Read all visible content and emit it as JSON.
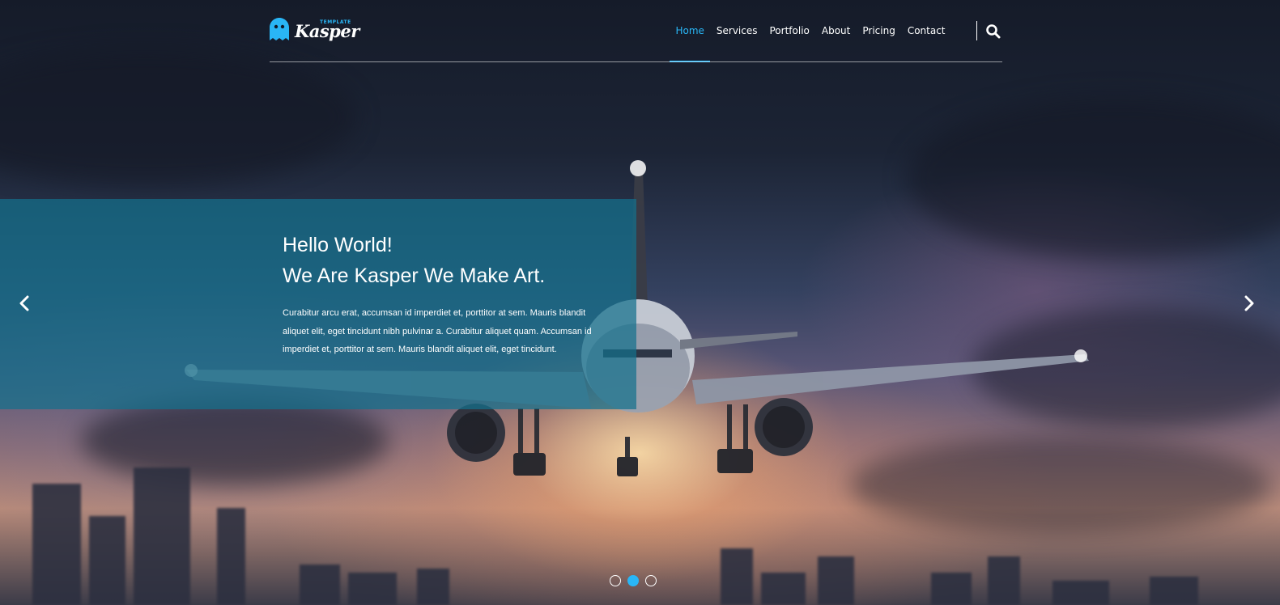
{
  "brand": {
    "name": "Kasper",
    "tagline": "TEMPLATE",
    "accent_color": "#29b6f6"
  },
  "nav": {
    "items": [
      {
        "label": "Home",
        "active": true
      },
      {
        "label": "Services",
        "active": false
      },
      {
        "label": "Portfolio",
        "active": false
      },
      {
        "label": "About",
        "active": false
      },
      {
        "label": "Pricing",
        "active": false
      },
      {
        "label": "Contact",
        "active": false
      }
    ],
    "search_icon": "search-icon"
  },
  "slide": {
    "heading_line1": "Hello World!",
    "heading_line2": "We Are Kasper We Make Art.",
    "body": "Curabitur arcu erat, accumsan id imperdiet et, porttitor at sem. Mauris blandit aliquet elit, eget tincidunt nibh pulvinar a. Curabitur aliquet quam. Accumsan id imperdiet et, porttitor at sem. Mauris blandit aliquet elit, eget tincidunt.",
    "prev_icon": "chevron-left-icon",
    "next_icon": "chevron-right-icon"
  },
  "slider": {
    "total_slides": 3,
    "active_index": 1
  }
}
